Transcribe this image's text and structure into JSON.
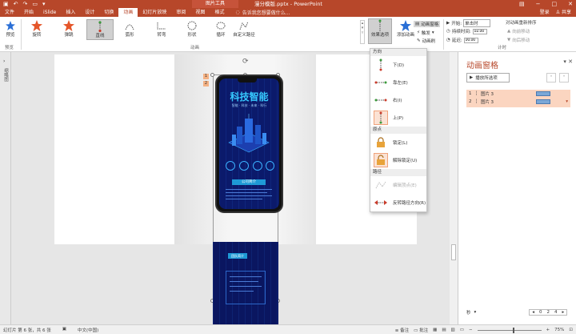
{
  "titlebar": {
    "contextual_tab": "图片工具",
    "document": "漫分模版.pptx - PowerPoint",
    "window_buttons": [
      "−",
      "□",
      "✕"
    ]
  },
  "tabs": {
    "items": [
      "文件",
      "开始",
      "iSlide",
      "插入",
      "设计",
      "切换",
      "动画",
      "幻灯片放映",
      "审阅",
      "视图",
      "格式"
    ],
    "active_index": 6,
    "search_placeholder": "告诉我您想要做什么...",
    "signin": "登录",
    "share": "共享"
  },
  "ribbon": {
    "preview_label": "预览",
    "preview_group": "预览",
    "animation_group": "动画",
    "timing_group": "计时",
    "animations": [
      {
        "label": "旋转",
        "icon": "spin-star-icon"
      },
      {
        "label": "弹跳",
        "icon": "bounce-star-icon"
      },
      {
        "label": "直线",
        "icon": "line-path-icon"
      },
      {
        "label": "弧形",
        "icon": "arc-path-icon"
      },
      {
        "label": "转弯",
        "icon": "turn-path-icon"
      },
      {
        "label": "形状",
        "icon": "shape-path-icon"
      },
      {
        "label": "循环",
        "icon": "loop-path-icon"
      },
      {
        "label": "自定义路径",
        "icon": "custom-path-icon"
      }
    ],
    "effect_options": "效果选项",
    "add_animation": "添加动画",
    "animation_pane": "动画窗格",
    "trigger": "触发",
    "animation_painter": "动画刷",
    "start_label": "开始:",
    "start_value": "单击时",
    "duration_label": "持续时间:",
    "duration_value": "02.00",
    "delay_label": "延迟:",
    "delay_value": "00.00",
    "reorder_title": "对动画重新排序",
    "move_earlier": "向前移动",
    "move_later": "向后移动"
  },
  "left_strip": {
    "label": "缩略图"
  },
  "slide": {
    "poster_title": "科技智能",
    "poster_subtitle": "智能 · 科技 · 未来 · 科行",
    "poster_button": "公司简介",
    "bottom_button": "团队简介",
    "animation_tags": [
      "1",
      "2"
    ]
  },
  "dropdown": {
    "section_direction": "方向",
    "directions": [
      {
        "label": "下(D)",
        "icon": "arrow-down-path-icon"
      },
      {
        "label": "靠左(E)",
        "icon": "arrow-left-path-icon"
      },
      {
        "label": "右(I)",
        "icon": "arrow-right-path-icon"
      },
      {
        "label": "上(P)",
        "icon": "arrow-up-path-icon"
      }
    ],
    "section_origin": "原点",
    "origins": [
      {
        "label": "锁定(L)",
        "icon": "lock-icon"
      },
      {
        "label": "解除锁定(U)",
        "icon": "unlock-icon"
      }
    ],
    "section_path": "路径",
    "paths": [
      {
        "label": "编辑顶点(E)",
        "icon": "edit-points-icon"
      },
      {
        "label": "反转路径方向(R)",
        "icon": "reverse-path-icon"
      }
    ]
  },
  "pane": {
    "title": "动画窗格",
    "play_button": "播放所选项",
    "items": [
      {
        "number": "1",
        "name": "图片 3"
      },
      {
        "number": "2",
        "name": "图片 3"
      }
    ],
    "seconds_label": "秒",
    "timeline": [
      "0",
      "2",
      "4"
    ]
  },
  "status": {
    "slide_info": "幻灯片 第 6 张，共 6 张",
    "language": "中文(中国)",
    "notes": "备注",
    "comments": "批注",
    "zoom": "75%"
  },
  "colors": {
    "accent": "#b7472a",
    "selection": "#fbd5c0"
  }
}
